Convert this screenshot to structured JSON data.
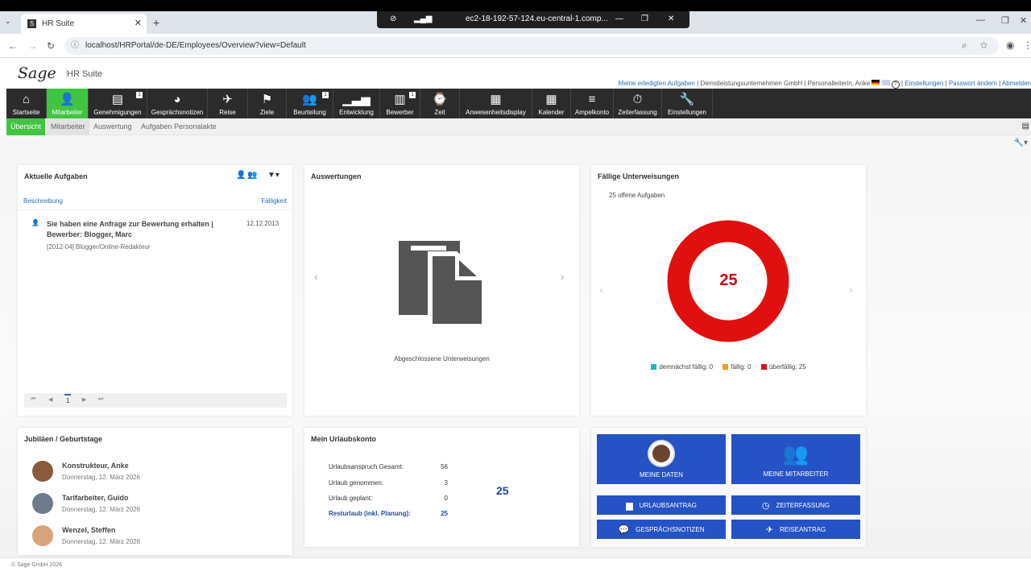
{
  "browser": {
    "tab_title": "HR Suite",
    "remote_host": "ec2-18-192-57-124.eu-central-1.comp...",
    "url": "localhost/HRPortal/de-DE/Employees/Overview?view=Default"
  },
  "header": {
    "logo": "Sage",
    "app_name": "HR Suite",
    "links": [
      "Meine erledigten Aufgaben",
      "Dienstleistungsunternehmen GmbH",
      "Personalleiterin, Anke",
      "Einstellungen",
      "Passwort ändern",
      "Abmelden"
    ]
  },
  "menu": [
    {
      "label": "Startseite",
      "icon": "⌂"
    },
    {
      "label": "Mitarbeiter",
      "icon": "👤"
    },
    {
      "label": "Genehmigungen",
      "icon": "▤",
      "badge": "1"
    },
    {
      "label": "Gesprächsnotizen",
      "icon": "◕"
    },
    {
      "label": "Reise",
      "icon": "✈"
    },
    {
      "label": "Ziele",
      "icon": "⚑"
    },
    {
      "label": "Beurteilung",
      "icon": "👥",
      "badge": "1"
    },
    {
      "label": "Entwicklung",
      "icon": "▁▃▅"
    },
    {
      "label": "Bewerber",
      "icon": "▥",
      "badge": "1"
    },
    {
      "label": "Zeit",
      "icon": "⌚"
    },
    {
      "label": "Anwesenheitsdisplay",
      "icon": "▦"
    },
    {
      "label": "Kalender",
      "icon": "▦"
    },
    {
      "label": "Ampelkonto",
      "icon": "≡"
    },
    {
      "label": "Zeiterfassung",
      "icon": "⏱"
    },
    {
      "label": "Einstellungen",
      "icon": "🔧"
    }
  ],
  "submenu": [
    "Übersicht",
    "Mitarbeiter",
    "Auswertung",
    "Aufgaben Personalakte"
  ],
  "tasks": {
    "title": "Aktuelle Aufgaben",
    "col_desc": "Beschreibung",
    "col_due": "Fälligkeit",
    "item_title": "Sie haben eine Anfrage zur Bewertung erhalten | Bewerber: Blogger, Marc",
    "item_date": "12.12.2013",
    "item_sub": "[2012-04] Blogger/Online-Redakteur",
    "page": "1"
  },
  "reports": {
    "title": "Auswertungen",
    "caption": "Abgeschlossene Unterweisungen"
  },
  "instructions": {
    "title": "Fällige Unterweisungen",
    "open": "25 offene Aufgaben",
    "count": "25",
    "legend": [
      {
        "label": "demnächst fällig: 0",
        "color": "#1fb3c9"
      },
      {
        "label": "fällig: 0",
        "color": "#f0a020"
      },
      {
        "label": "überfällig: 25",
        "color": "#e01010"
      }
    ]
  },
  "birthdays": {
    "title": "Jubiläen / Geburtstage",
    "people": [
      {
        "name": "Konstrukteur, Anke",
        "date": "Donnerstag, 12. März 2026"
      },
      {
        "name": "Tarifarbeiter, Guido",
        "date": "Donnerstag, 12. März 2026"
      },
      {
        "name": "Wenzel, Steffen",
        "date": "Donnerstag, 12. März 2026"
      }
    ]
  },
  "vacation": {
    "title": "Mein Urlaubskonto",
    "rows": [
      {
        "label": "Urlaubsanspruch Gesamt:",
        "value": "56"
      },
      {
        "label": "Urlaub genommen:",
        "value": "3"
      },
      {
        "label": "Urlaub geplant:",
        "value": "0"
      },
      {
        "label": "Resturlaub (inkl. Planung):",
        "value": "25"
      }
    ],
    "big": "25"
  },
  "actions": {
    "my_data": "Meine Daten",
    "my_employees": "Meine Mitarbeiter",
    "vacation_request": "Urlaubsantrag",
    "time_tracking": "Zeiterfassung",
    "notes": "Gesprächsnotizen",
    "travel": "Reiseantrag"
  },
  "footer": "© Sage GmbH 2026",
  "colors": {
    "accent": "#41c541",
    "menubar": "#2b2b2b",
    "button": "#2552c4",
    "donut": "#e01010"
  }
}
